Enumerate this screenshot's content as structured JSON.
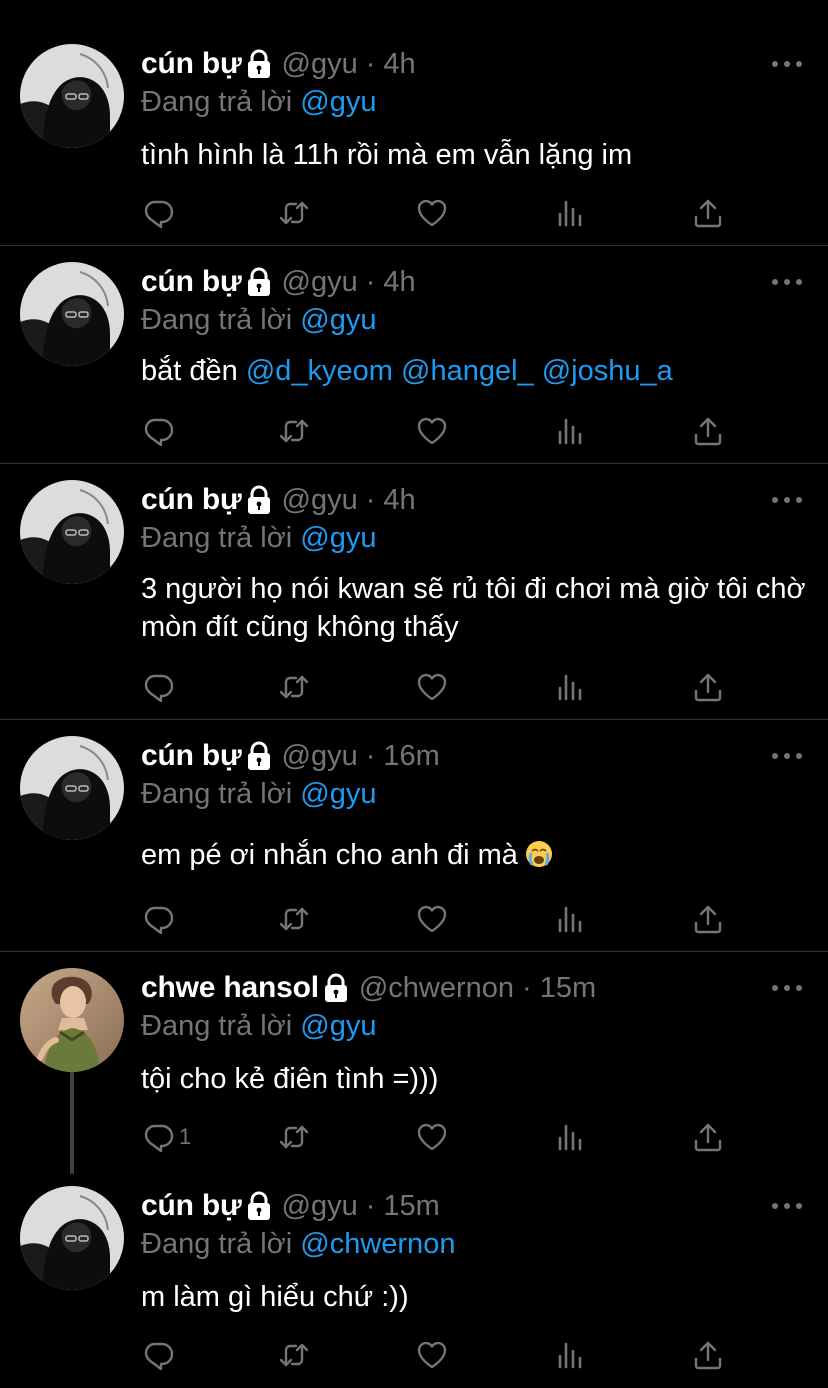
{
  "ui": {
    "reply_prefix": "Đang trả lời",
    "colors": {
      "background": "#000000",
      "text": "#ffffff",
      "muted": "#71767b",
      "accent": "#1d9bf0",
      "divider": "#2f3336"
    },
    "icons": [
      "lock-icon",
      "more-icon",
      "reply-icon",
      "retweet-icon",
      "like-icon",
      "analytics-icon",
      "share-icon"
    ]
  },
  "tweets": [
    {
      "name": "cún bự",
      "handle": "@gyu",
      "separator": "·",
      "time": "4h",
      "reply_to": "@gyu",
      "text_parts": [
        {
          "text": "tình hình là 11h rồi mà em vẫn lặng im",
          "mention": false
        }
      ],
      "reply_count": ""
    },
    {
      "name": "cún bự",
      "handle": "@gyu",
      "separator": "·",
      "time": "4h",
      "reply_to": "@gyu",
      "text_parts": [
        {
          "text": "bắt đền ",
          "mention": false
        },
        {
          "text": "@d_kyeom",
          "mention": true
        },
        {
          "text": " ",
          "mention": false
        },
        {
          "text": "@hangel_",
          "mention": true
        },
        {
          "text": " ",
          "mention": false
        },
        {
          "text": "@joshu_a",
          "mention": true
        }
      ],
      "reply_count": ""
    },
    {
      "name": "cún bự",
      "handle": "@gyu",
      "separator": "·",
      "time": "4h",
      "reply_to": "@gyu",
      "text_parts": [
        {
          "text": "3 người họ nói kwan sẽ rủ tôi đi chơi mà giờ tôi chờ mòn đít cũng không thấy",
          "mention": false
        }
      ],
      "reply_count": ""
    },
    {
      "name": "cún bự",
      "handle": "@gyu",
      "separator": "·",
      "time": "16m",
      "reply_to": "@gyu",
      "text_parts": [
        {
          "text": "em pé ơi nhắn cho anh đi mà",
          "mention": false
        }
      ],
      "emoji": "loudly-crying-face",
      "reply_count": ""
    },
    {
      "name": "chwe hansol",
      "handle": "@chwernon",
      "separator": "·",
      "time": "15m",
      "reply_to": "@gyu",
      "text_parts": [
        {
          "text": "tội cho kẻ điên tình =)))",
          "mention": false
        }
      ],
      "reply_count": "1"
    },
    {
      "name": "cún bự",
      "handle": "@gyu",
      "separator": "·",
      "time": "15m",
      "reply_to": "@chwernon",
      "text_parts": [
        {
          "text": "m làm gì hiểu chứ :))",
          "mention": false
        }
      ],
      "reply_count": ""
    }
  ]
}
